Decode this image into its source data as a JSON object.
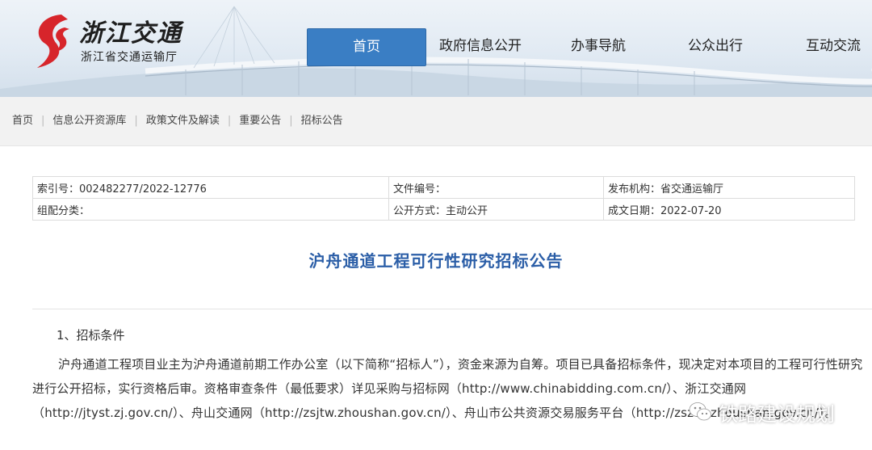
{
  "site": {
    "logo_cn": "浙江交通",
    "logo_sub": "浙江省交通运输厅"
  },
  "nav": {
    "items": [
      {
        "label": "首页",
        "active": true
      },
      {
        "label": "政府信息公开"
      },
      {
        "label": "办事导航"
      },
      {
        "label": "公众出行"
      },
      {
        "label": "互动交流"
      }
    ]
  },
  "breadcrumb": [
    "首页",
    "信息公开资源库",
    "政策文件及解读",
    "重要公告",
    "招标公告"
  ],
  "meta": {
    "index_no": "索引号：002482277/2022-12776",
    "doc_no": "文件编号：",
    "publisher": "发布机构：省交通运输厅",
    "category": "组配分类：",
    "disclosure": "公开方式：主动公开",
    "date": "成文日期：2022-07-20"
  },
  "article": {
    "title": "沪舟通道工程可行性研究招标公告",
    "section_1": "1、招标条件",
    "paragraph_1": "沪舟通道工程项目业主为沪舟通道前期工作办公室（以下简称“招标人”），资金来源为自筹。项目已具备招标条件，现决定对本项目的工程可行性研究进行公开招标，实行资格后审。资格审查条件（最低要求）详见采购与招标网（http://www.chinabidding.com.cn/）、浙江交通网（http://jtyst.zj.gov.cn/）、舟山交通网（http://zsjtw.zhoushan.gov.cn/）、舟山市公共资源交易服务平台（http://zsztb.zhoushan.gov.cn/）。"
  },
  "watermark": {
    "text": "铁路建设规划"
  }
}
